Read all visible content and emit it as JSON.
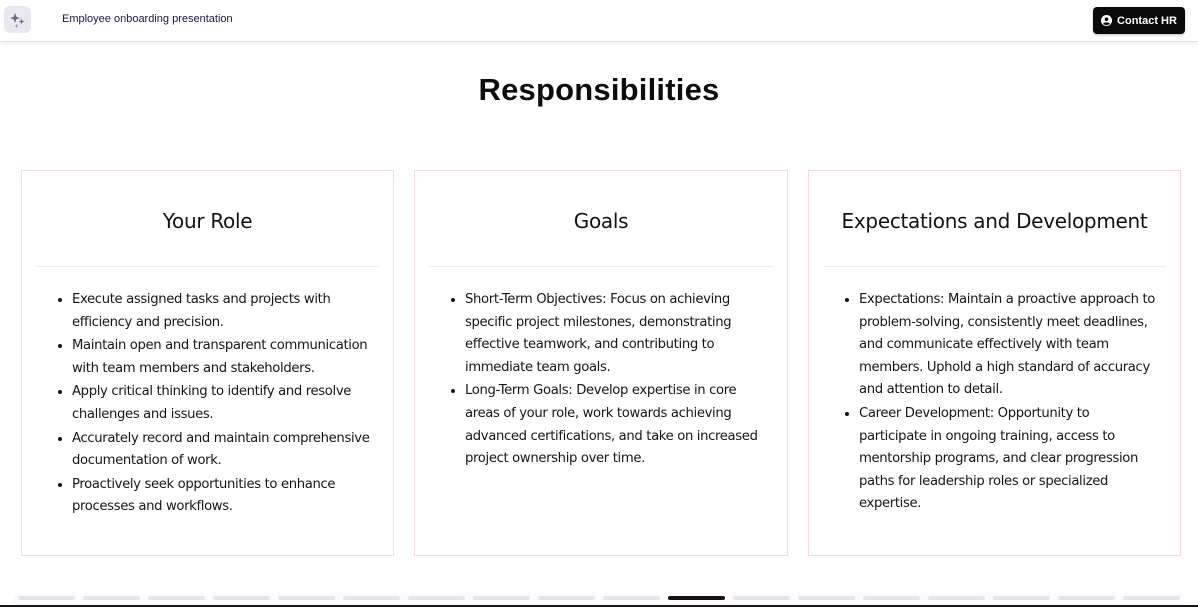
{
  "header": {
    "logo_icon": "sparkles-icon",
    "title": "Employee onboarding presentation",
    "contact_button": {
      "label": "Contact HR",
      "icon": "user-circle-icon"
    }
  },
  "slide": {
    "title": "Responsibilities",
    "cards": [
      {
        "heading": "Your Role",
        "items": [
          "Execute assigned tasks and projects with efficiency and precision.",
          "Maintain open and transparent communication with team members and stakeholders.",
          "Apply critical thinking to identify and resolve challenges and issues.",
          "Accurately record and maintain comprehensive documentation of work.",
          "Proactively seek opportunities to enhance processes and workflows."
        ]
      },
      {
        "heading": "Goals",
        "items": [
          "Short-Term Objectives: Focus on achieving specific project milestones, demonstrating effective teamwork, and contributing to immediate team goals.",
          "Long-Term Goals: Develop expertise in core areas of your role, work towards achieving advanced certifications, and take on increased project ownership over time."
        ]
      },
      {
        "heading": "Expectations and Development",
        "items": [
          "Expectations: Maintain a proactive approach to problem-solving, consistently meet deadlines, and communicate effectively with team members. Uphold a high standard of accuracy and attention to detail.",
          "Career Development: Opportunity to participate in ongoing training, access to mentorship programs, and clear progression paths for leadership roles or specialized expertise."
        ]
      }
    ]
  },
  "progress": {
    "total_slides": 18,
    "current_slide": 11
  },
  "colors": {
    "accent_dark": "#0a0a0a",
    "card_border": "#f6dadd",
    "progress_inactive": "#e5e4ec",
    "progress_active": "#1c0f12",
    "title_text": "#1b1642"
  }
}
